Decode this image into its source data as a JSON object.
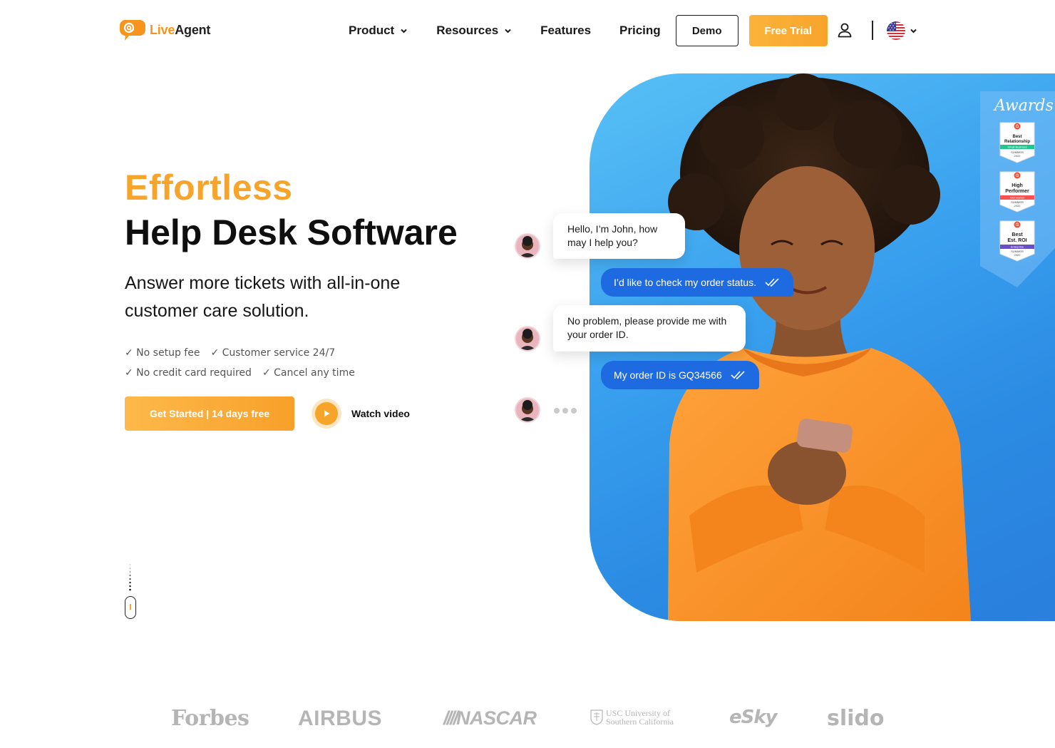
{
  "brand": {
    "live": "Live",
    "agent": "Agent"
  },
  "nav": {
    "product": "Product",
    "resources": "Resources",
    "features": "Features",
    "pricing": "Pricing",
    "demo": "Demo",
    "free_trial": "Free Trial"
  },
  "icons": {
    "logo": "liveagent-logo-icon",
    "user": "user-icon",
    "flag": "us-flag-icon",
    "chevron": "chevron-down-icon",
    "play": "play-icon",
    "read_ticks": "double-check-icon"
  },
  "hero": {
    "title_highlight": "Effortless",
    "title": "Help Desk Software",
    "subtitle": "Answer more tickets with all-in-one customer care solution.",
    "checks": [
      "✓ No setup fee",
      "✓ Customer service 24/7",
      "✓ No credit card required",
      "✓ Cancel any time"
    ],
    "cta": "Get Started | 14 days free",
    "watch_video": "Watch video"
  },
  "chat": {
    "messages": [
      {
        "from": "agent",
        "text": "Hello, I’m John, how may I help you?"
      },
      {
        "from": "customer",
        "text": "I’d like to check my order status."
      },
      {
        "from": "agent",
        "text": "No problem, please provide me with your order ID."
      },
      {
        "from": "customer",
        "text": "My order ID is GQ34566"
      }
    ]
  },
  "awards": {
    "title": "Awards",
    "badges": [
      {
        "g": "G",
        "lines": [
          "Best",
          "Relationship"
        ],
        "strip": "Small Business",
        "season": "SUMMER",
        "year": "2022",
        "strip_color": "#21c58e"
      },
      {
        "g": "G",
        "lines": [
          "High",
          "Performer"
        ],
        "strip": "Mid-Market",
        "season": "SUMMER",
        "year": "2022",
        "strip_color": "#ff4f4f"
      },
      {
        "g": "G",
        "lines": [
          "Best",
          "Est. ROI"
        ],
        "strip": "Enterprise",
        "season": "SUMMER",
        "year": "2022",
        "strip_color": "#6a4ec3"
      }
    ]
  },
  "logos": {
    "forbes": "Forbes",
    "airbus": "AIRBUS",
    "nascar": "NASCAR",
    "usc_1": "USC University of",
    "usc_2": "Southern California",
    "esky": "eSky",
    "slido": "slido"
  },
  "colors": {
    "accent": "#f7a42b",
    "chat_blue": "#1e6ae0",
    "hero_bg": "#3aa1ef"
  }
}
